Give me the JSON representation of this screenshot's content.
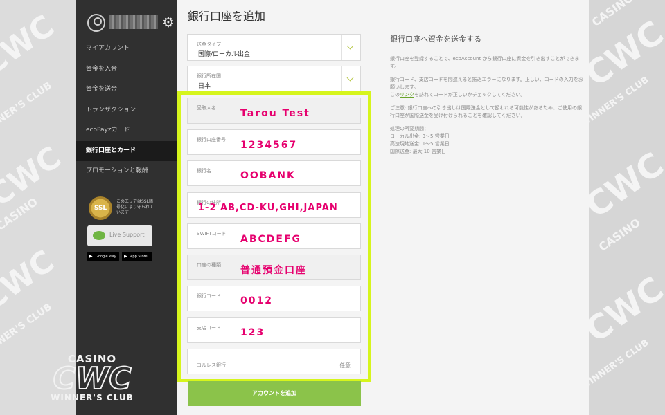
{
  "sidebar": {
    "nav": [
      "マイアカウント",
      "資金を入金",
      "資金を送金",
      "トランザクション",
      "ecoPayzカード",
      "銀行口座とカード",
      "プロモーションと報酬"
    ],
    "active_index": 5,
    "ssl_badge": "SSL",
    "ssl_text": "このエリアはSSL暗号化により守られています",
    "live_support": "Live Support",
    "google_play": "Google Play",
    "app_store": "App Store"
  },
  "logo": {
    "line1": "CASINO",
    "line2": "CWC",
    "line3": "WINNER'S CLUB"
  },
  "watermark": {
    "text": "CASINO CWC WINNER'S CLUB"
  },
  "main": {
    "title": "銀行口座を追加",
    "fields": {
      "transfer_type": {
        "label": "送金タイプ",
        "value": "国際/ローカル出金"
      },
      "bank_country": {
        "label": "銀行所在国",
        "value": "日本"
      },
      "recipient": {
        "label": "受取人名",
        "value": "Tarou Test"
      },
      "account_number": {
        "label": "銀行口座番号",
        "value": "1234567"
      },
      "bank_name": {
        "label": "銀行名",
        "value": "OOBANK"
      },
      "bank_address": {
        "label": "銀行の住所",
        "value": "1-2 AB,CD-KU,GHI,JAPAN"
      },
      "swift": {
        "label": "SWIFTコード",
        "value": "ABCDEFG"
      },
      "account_type": {
        "label": "口座の種類",
        "value": "普通預金口座"
      },
      "bank_code": {
        "label": "銀行コード",
        "value": "0012"
      },
      "branch_code": {
        "label": "支店コード",
        "value": "123"
      },
      "correspondent": {
        "label": "コルレス銀行",
        "optional": "任意"
      }
    },
    "submit": "アカウントを追加"
  },
  "info": {
    "title": "銀行口座へ資金を送金する",
    "p1": "銀行口座を登録することで、ecoAccount から銀行口座に資金を引き出すことができます。",
    "p2": "銀行コード、支店コードを間違えると振込エラーになります。正しい、コードの入力をお願いします。",
    "p2b_pre": "この",
    "p2b_link": "リンク",
    "p2b_post": "を訪れてコードが正しいかチェックしてください。",
    "p3": "ご注意: 銀行口座への引き出しは国際送金として扱われる可能性があるため、ご使用の銀行口座が国際送金を受け付けられることを確認してください。",
    "p4_title": "処理の所要期間：",
    "p4_l1": "ローカル出金: 3〜5 営業日",
    "p4_l2": "高速現地送金: 1〜5 営業日",
    "p4_l3": "国際送金: 最大 10 営業日"
  },
  "colors": {
    "highlight": "#d6f51c",
    "accent_text": "#e6006e",
    "button": "#8bc34a",
    "sidebar": "#303030"
  }
}
